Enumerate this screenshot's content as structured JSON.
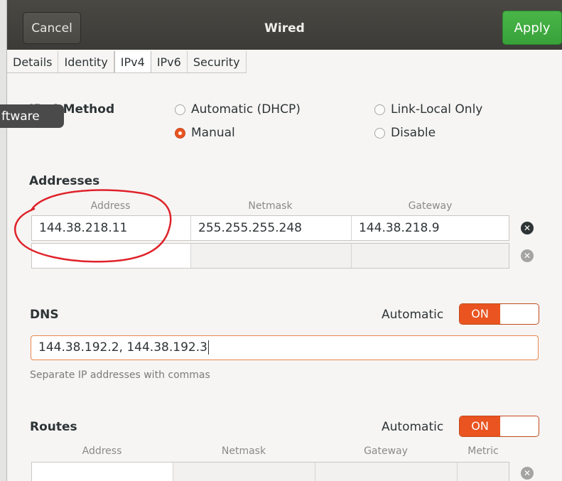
{
  "window": {
    "title": "Wired",
    "cancel_label": "Cancel",
    "apply_label": "Apply"
  },
  "tabs": [
    {
      "label": "Details"
    },
    {
      "label": "Identity"
    },
    {
      "label": "IPv4",
      "active": true
    },
    {
      "label": "IPv6"
    },
    {
      "label": "Security"
    }
  ],
  "tooltip": {
    "text": "ftware"
  },
  "ipv4_method": {
    "label": "IPv4 Method",
    "options": [
      {
        "label": "Automatic (DHCP)",
        "selected": false
      },
      {
        "label": "Link-Local Only",
        "selected": false
      },
      {
        "label": "Manual",
        "selected": true
      },
      {
        "label": "Disable",
        "selected": false
      }
    ]
  },
  "addresses": {
    "heading": "Addresses",
    "columns": [
      "Address",
      "Netmask",
      "Gateway"
    ],
    "rows": [
      {
        "address": "144.38.218.11",
        "netmask": "255.255.255.248",
        "gateway": "144.38.218.9"
      },
      {
        "address": "",
        "netmask": "",
        "gateway": ""
      }
    ]
  },
  "dns": {
    "heading": "DNS",
    "automatic_label": "Automatic",
    "switch_label": "ON",
    "value": "144.38.192.2, 144.38.192.3",
    "hint": "Separate IP addresses with commas"
  },
  "routes": {
    "heading": "Routes",
    "automatic_label": "Automatic",
    "switch_label": "ON",
    "columns": [
      "Address",
      "Netmask",
      "Gateway",
      "Metric"
    ]
  },
  "colors": {
    "accent": "#e95420",
    "apply_green": "#3daa3f",
    "annotation_red": "#e0222a"
  }
}
